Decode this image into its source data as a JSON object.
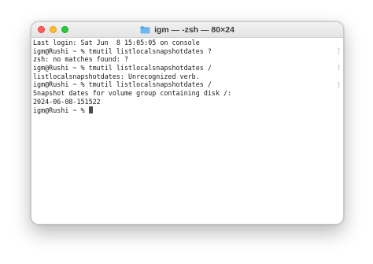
{
  "window": {
    "title": "igm — -zsh — 80×24",
    "folder_icon": "folder-icon"
  },
  "terminal": {
    "lines": [
      "Last login: Sat Jun  8 15:05:05 on console",
      "igm@Rushi ~ % tmutil listlocalsnapshotdates ?",
      "zsh: no matches found: ?",
      "igm@Rushi ~ % tmutil listlocalsnapshotdates /",
      "listlocalsnapshotdates: Unrecognized verb.",
      "igm@Rushi ~ % tmutil listlocalsnapshotdates /",
      "Snapshot dates for volume group containing disk /:",
      "2024-06-08-151522"
    ],
    "prompt": "igm@Rushi ~ % ",
    "mark_symbol": "]"
  },
  "colors": {
    "close": "#ff5f57",
    "minimize": "#febc2e",
    "maximize": "#28c840",
    "folder": "#4aa3df"
  }
}
